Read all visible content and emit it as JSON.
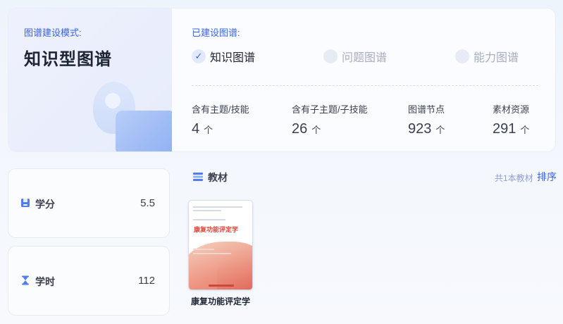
{
  "mode": {
    "label": "图谱建设模式:",
    "value": "知识型图谱"
  },
  "built": {
    "label": "已建设图谱:",
    "items": [
      {
        "name": "知识图谱",
        "checked": true
      },
      {
        "name": "问题图谱",
        "checked": false
      },
      {
        "name": "能力图谱",
        "checked": false
      }
    ]
  },
  "stats": [
    {
      "label": "含有主题/技能",
      "value": "4",
      "unit": "个"
    },
    {
      "label": "含有子主题/子技能",
      "value": "26",
      "unit": "个"
    },
    {
      "label": "图谱节点",
      "value": "923",
      "unit": "个"
    },
    {
      "label": "素材资源",
      "value": "291",
      "unit": "个"
    }
  ],
  "credits": {
    "label": "学分",
    "value": "5.5",
    "icon": "credit-icon"
  },
  "hours": {
    "label": "学时",
    "value": "112",
    "icon": "hourglass-icon"
  },
  "textbook": {
    "title": "教材",
    "count": "共1本教材",
    "sort": "排序",
    "books": [
      {
        "cover_title": "康复功能评定学",
        "name": "康复功能评定学"
      }
    ]
  },
  "colors": {
    "accent": "#3a63e0",
    "icon_blue": "#4f7df0",
    "muted": "#a7aec2"
  }
}
